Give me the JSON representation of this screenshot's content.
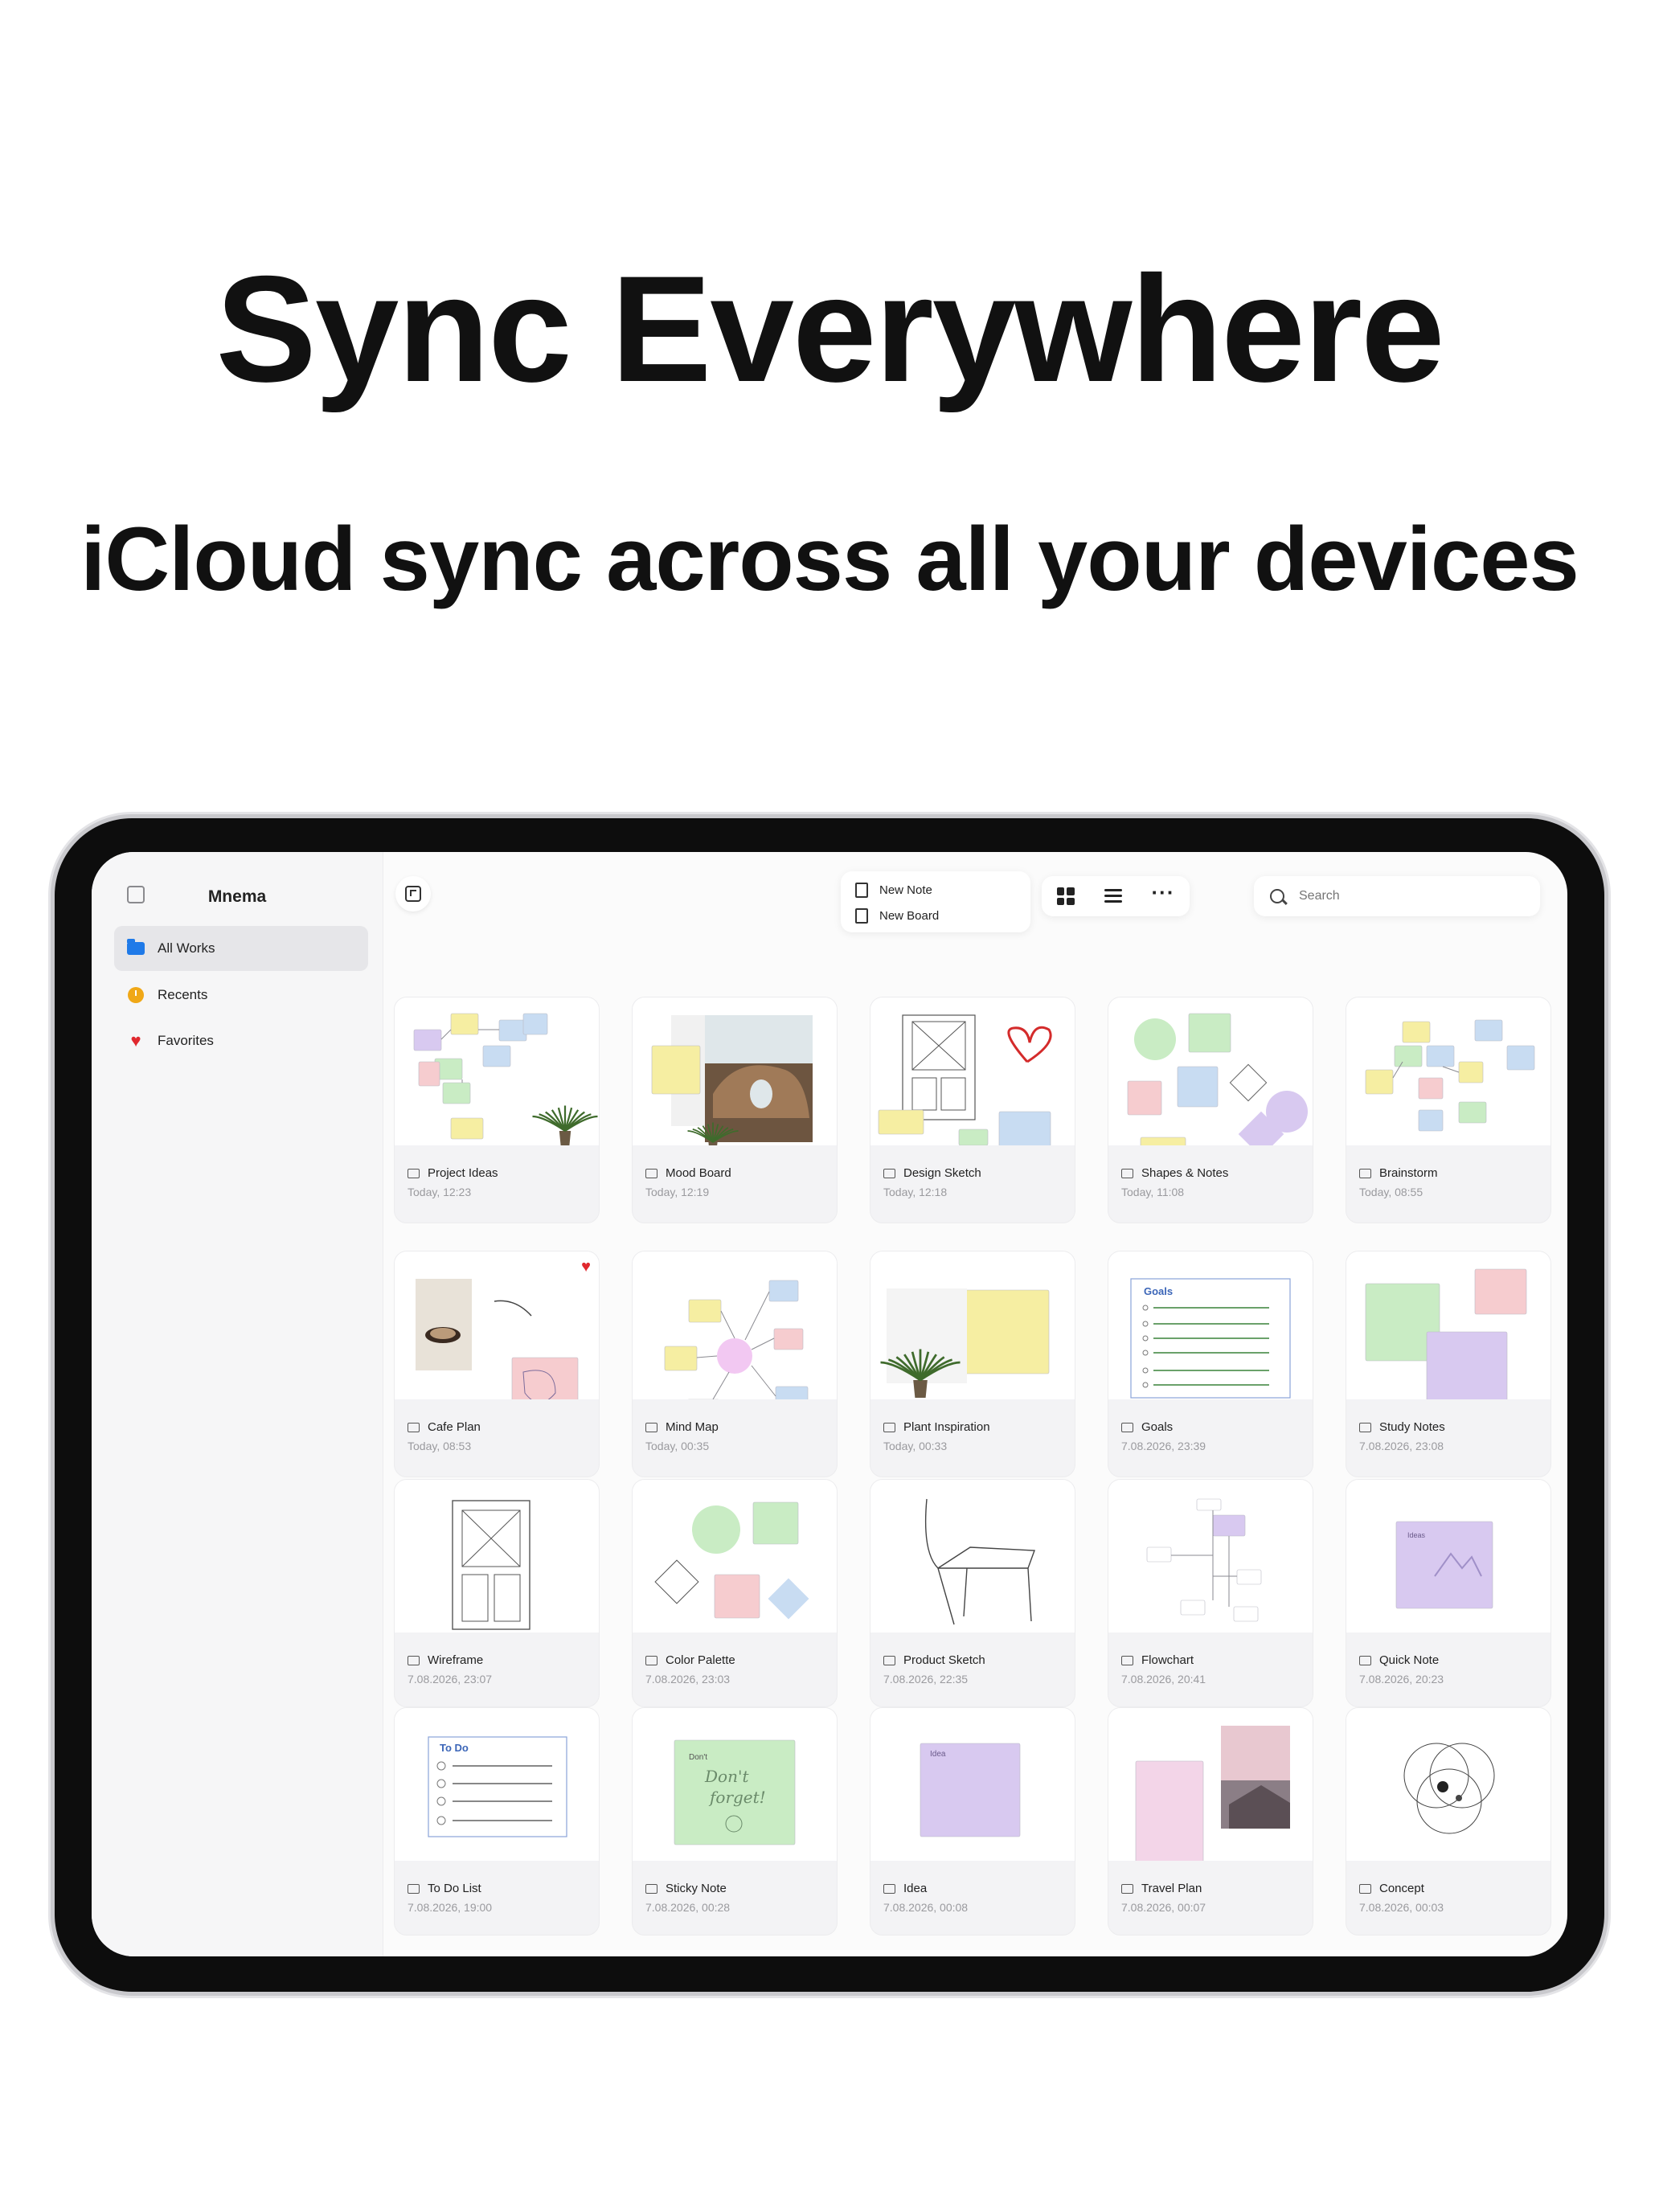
{
  "headline": "Sync Everywhere",
  "subhead": "iCloud sync across all your devices",
  "app": {
    "title": "Mnema",
    "sidebar": {
      "items": [
        {
          "label": "All Works",
          "icon": "folder-icon",
          "active": true
        },
        {
          "label": "Recents",
          "icon": "clock-icon",
          "active": false
        },
        {
          "label": "Favorites",
          "icon": "heart-icon",
          "active": false
        }
      ]
    },
    "toolbar": {
      "new_note": "New Note",
      "new_board": "New Board",
      "search_placeholder": "Search"
    },
    "boards": [
      {
        "name": "Project Ideas",
        "date": "Today, 12:23",
        "thumb": "flow-notes"
      },
      {
        "name": "Mood Board",
        "date": "Today, 12:19",
        "thumb": "photo-rock"
      },
      {
        "name": "Design Sketch",
        "date": "Today, 12:18",
        "thumb": "wireframe-heart"
      },
      {
        "name": "Shapes & Notes",
        "date": "Today, 11:08",
        "thumb": "shapes"
      },
      {
        "name": "Brainstorm",
        "date": "Today, 08:55",
        "thumb": "flow-notes-2"
      },
      {
        "name": "Cafe Plan",
        "date": "Today, 08:53",
        "thumb": "coffee",
        "favorite": true
      },
      {
        "name": "Mind Map",
        "date": "Today, 00:35",
        "thumb": "mindmap"
      },
      {
        "name": "Plant Inspiration",
        "date": "Today, 00:33",
        "thumb": "plant-note"
      },
      {
        "name": "Goals",
        "date": "7.08.2026, 23:39",
        "thumb": "goals-list"
      },
      {
        "name": "Study Notes",
        "date": "7.08.2026, 23:08",
        "thumb": "stacked-notes"
      },
      {
        "name": "Wireframe",
        "date": "7.08.2026, 23:07",
        "thumb": "wireframe"
      },
      {
        "name": "Color Palette",
        "date": "7.08.2026, 23:03",
        "thumb": "palette"
      },
      {
        "name": "Product Sketch",
        "date": "7.08.2026, 22:35",
        "thumb": "chair"
      },
      {
        "name": "Flowchart",
        "date": "7.08.2026, 20:41",
        "thumb": "flowchart"
      },
      {
        "name": "Quick Note",
        "date": "7.08.2026, 20:23",
        "thumb": "purple-note"
      },
      {
        "name": "To Do List",
        "date": "7.08.2026, 19:00",
        "thumb": "todo"
      },
      {
        "name": "Sticky Note",
        "date": "7.08.2026, 00:28",
        "thumb": "sticky"
      },
      {
        "name": "Idea",
        "date": "7.08.2026, 00:08",
        "thumb": "idea-note"
      },
      {
        "name": "Travel Plan",
        "date": "7.08.2026, 00:07",
        "thumb": "travel"
      },
      {
        "name": "Concept",
        "date": "7.08.2026, 00:03",
        "thumb": "venn"
      }
    ],
    "thumb_text": {
      "todo": "To Do",
      "goals": "Goals",
      "sticky": "Don't forget!",
      "idea": "Idea"
    }
  },
  "colors": {
    "accent": "#1f7ae8",
    "favorite": "#e0282e",
    "recents": "#f0a817",
    "note_yellow": "#f6eea2",
    "note_green": "#c9ecc4",
    "note_blue": "#c8dcf2",
    "note_purple": "#d8c9f0",
    "note_pink": "#f6cccf"
  }
}
